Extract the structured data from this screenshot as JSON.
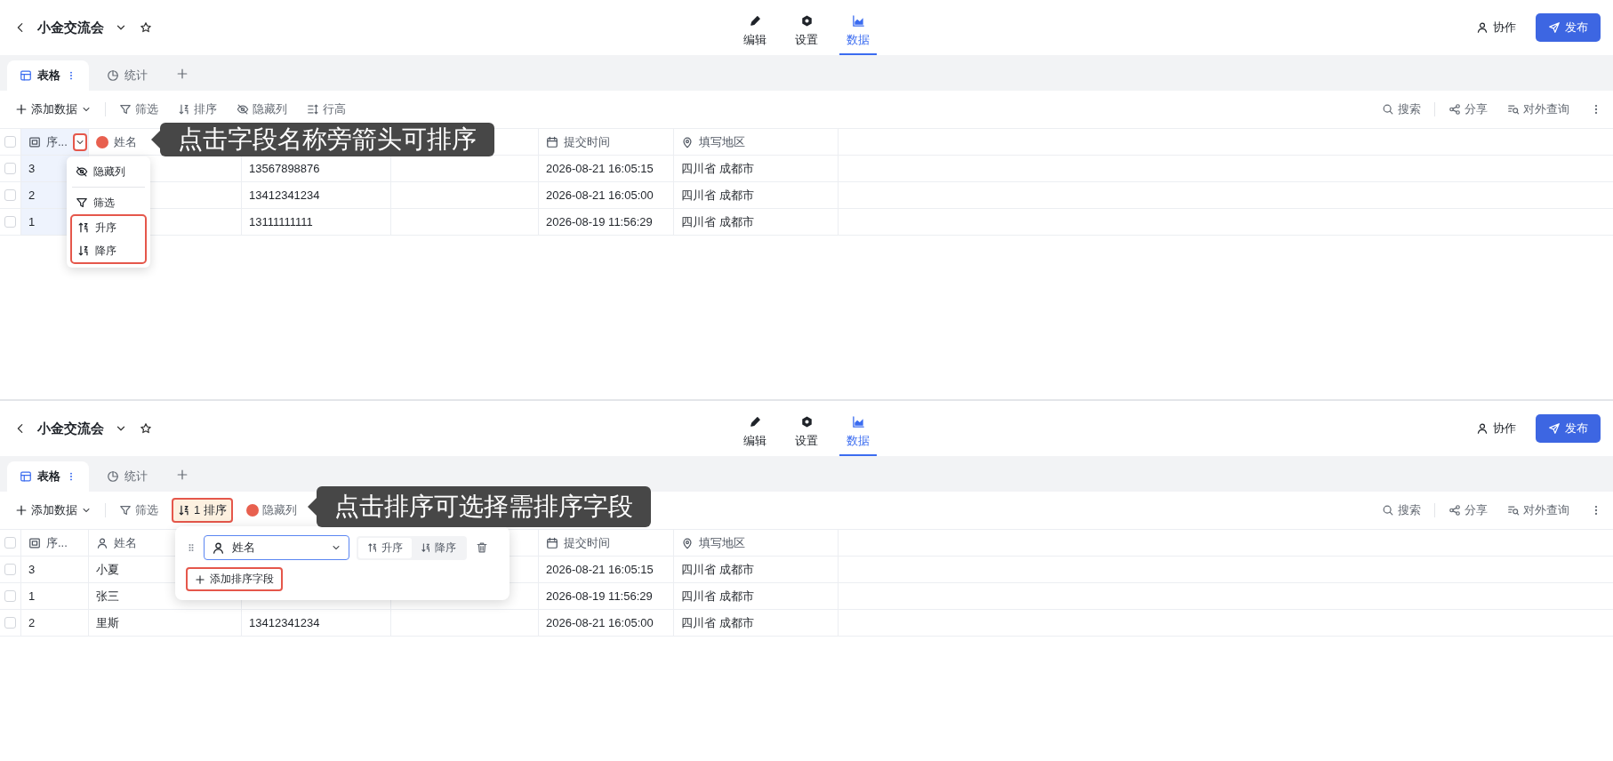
{
  "panels": [
    {
      "kind": "column-menu",
      "header": {
        "title": "小金交流会",
        "nav": [
          {
            "label": "编辑",
            "kind": "edit",
            "selected": false
          },
          {
            "label": "设置",
            "kind": "settings",
            "selected": false
          },
          {
            "label": "数据",
            "kind": "data",
            "selected": true
          }
        ],
        "collab": "协作",
        "publish": "发布"
      },
      "tabs": [
        {
          "label": "表格",
          "kind": "table",
          "selected": true
        },
        {
          "label": "统计",
          "kind": "stats",
          "selected": false
        }
      ],
      "toolbar_left": [
        {
          "label": "添加数据",
          "kind": "add",
          "selected": false,
          "annotated": false,
          "marker": false
        },
        {
          "label": "筛选",
          "kind": "filter",
          "selected": false,
          "annotated": false,
          "marker": false
        },
        {
          "label": "排序",
          "kind": "sort",
          "selected": false,
          "annotated": false,
          "marker": false
        },
        {
          "label": "隐藏列",
          "kind": "hide",
          "selected": false,
          "annotated": false,
          "marker": false
        },
        {
          "label": "行高",
          "kind": "rowheight",
          "selected": false,
          "annotated": false,
          "marker": false
        }
      ],
      "toolbar_right": [
        {
          "label": "搜索",
          "kind": "search"
        },
        {
          "label": "分享",
          "kind": "share"
        },
        {
          "label": "对外查询",
          "kind": "query"
        }
      ],
      "columns": [
        {
          "label": "序...",
          "kind": "number",
          "selected": true,
          "dropdown": true,
          "annotated": true,
          "marker": false
        },
        {
          "label": "姓名",
          "selected": false,
          "dropdown": false,
          "annotated": false,
          "marker": true
        },
        null,
        null,
        {
          "label": "提交时间",
          "kind": "date",
          "selected": false,
          "dropdown": false,
          "annotated": false,
          "marker": false
        },
        {
          "label": "填写地区",
          "kind": "location",
          "selected": false,
          "dropdown": false,
          "annotated": false,
          "marker": false
        }
      ],
      "select_all_checked": false,
      "rows": [
        {
          "checked": false,
          "cells": [
            "3",
            null,
            "13567898876",
            null,
            "2026-08-21 16:05:15",
            "四川省 成都市"
          ]
        },
        {
          "checked": false,
          "cells": [
            "2",
            null,
            "13412341234",
            null,
            "2026-08-21 16:05:00",
            "四川省 成都市"
          ]
        },
        {
          "checked": false,
          "cells": [
            "1",
            null,
            "13111111111",
            null,
            "2026-08-19 11:56:29",
            "四川省 成都市"
          ]
        }
      ],
      "menu": [
        {
          "label": "隐藏列",
          "kind": "hide",
          "divider_before": false,
          "annotated": false
        },
        {
          "label": "筛选",
          "kind": "filter",
          "divider_before": true,
          "annotated": false
        },
        {
          "label": "升序",
          "kind": "asc",
          "divider_before": false,
          "annotated": true
        },
        {
          "label": "降序",
          "kind": "desc",
          "divider_before": false,
          "annotated": true
        }
      ],
      "callout": "点击字段名称旁箭头可排序"
    },
    {
      "kind": "sort-popup",
      "header": {
        "title": "小金交流会",
        "nav": [
          {
            "label": "编辑",
            "kind": "edit",
            "selected": false
          },
          {
            "label": "设置",
            "kind": "settings",
            "selected": false
          },
          {
            "label": "数据",
            "kind": "data",
            "selected": true
          }
        ],
        "collab": "协作",
        "publish": "发布"
      },
      "tabs": [
        {
          "label": "表格",
          "kind": "table",
          "selected": true
        },
        {
          "label": "统计",
          "kind": "stats",
          "selected": false
        }
      ],
      "toolbar_left": [
        {
          "label": "添加数据",
          "kind": "add",
          "selected": false,
          "annotated": false,
          "marker": false
        },
        {
          "label": "筛选",
          "kind": "filter",
          "selected": false,
          "annotated": false,
          "marker": false
        },
        {
          "label": "1 排序",
          "kind": "sort",
          "selected": true,
          "annotated": true,
          "marker": false
        },
        {
          "label": "隐藏列",
          "kind": "hide",
          "selected": false,
          "annotated": false,
          "marker": true
        }
      ],
      "toolbar_right": [
        {
          "label": "搜索",
          "kind": "search"
        },
        {
          "label": "分享",
          "kind": "share"
        },
        {
          "label": "对外查询",
          "kind": "query"
        }
      ],
      "columns": [
        {
          "label": "序...",
          "kind": "number",
          "selected": false,
          "dropdown": false,
          "annotated": false,
          "marker": false
        },
        {
          "label": "姓名",
          "kind": "person",
          "selected": false,
          "dropdown": false,
          "annotated": false,
          "marker": false
        },
        null,
        null,
        {
          "label": "提交时间",
          "kind": "date",
          "selected": false,
          "dropdown": false,
          "annotated": false,
          "marker": false
        },
        {
          "label": "填写地区",
          "kind": "location",
          "selected": false,
          "dropdown": false,
          "annotated": false,
          "marker": false
        }
      ],
      "select_all_checked": false,
      "rows": [
        {
          "checked": false,
          "cells": [
            "3",
            "小夏",
            null,
            null,
            "2026-08-21 16:05:15",
            "四川省 成都市"
          ]
        },
        {
          "checked": false,
          "cells": [
            "1",
            "张三",
            null,
            null,
            "2026-08-19 11:56:29",
            "四川省 成都市"
          ]
        },
        {
          "checked": false,
          "cells": [
            "2",
            "里斯",
            "13412341234",
            null,
            "2026-08-21 16:05:00",
            "四川省 成都市"
          ]
        }
      ],
      "sort_popup": {
        "field": "姓名",
        "order": [
          {
            "label": "升序",
            "kind": "asc",
            "selected": true
          },
          {
            "label": "降序",
            "kind": "desc",
            "selected": false
          }
        ],
        "add_label": "添加排序字段",
        "add_annotated": true
      },
      "callout": "点击排序可选择需排序字段"
    }
  ]
}
